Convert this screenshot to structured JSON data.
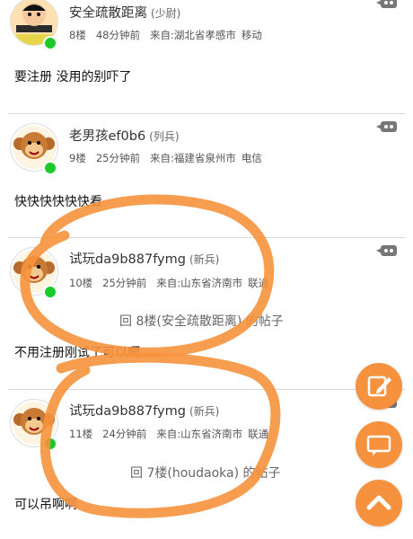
{
  "colors": {
    "accent": "#f6923d",
    "online": "#1cc92b",
    "divider": "#d8d8d8"
  },
  "posts": [
    {
      "avatar": "crayon-shin-chan-avatar",
      "username": "安全疏散距离",
      "rank": "(少尉)",
      "floor": "8楼",
      "time": "48分钟前",
      "location": "来自:湖北省孝感市",
      "carrier": "移动",
      "content": "要注册 没用的别吓了"
    },
    {
      "avatar": "monkey-avatar",
      "username": "老男孩ef0b6",
      "rank": "(列兵)",
      "floor": "9楼",
      "time": "25分钟前",
      "location": "来自:福建省泉州市",
      "carrier": "电信",
      "content": "快快快快快快看"
    },
    {
      "avatar": "monkey-avatar",
      "username": "试玩da9b887fymg",
      "rank": "(新兵)",
      "floor": "10楼",
      "time": "25分钟前",
      "location": "来自:山东省济南市",
      "carrier": "联通",
      "quote": "回 8楼(安全疏散距离) 的帖子",
      "content": "不用注册刚试了可以啊"
    },
    {
      "avatar": "monkey-avatar",
      "username": "试玩da9b887fymg",
      "rank": "(新兵)",
      "floor": "11楼",
      "time": "24分钟前",
      "location": "来自:山东省济南市",
      "carrier": "联通",
      "quote": "回 7楼(houdaoka) 的帖子",
      "content": "可以吊啊啊"
    }
  ],
  "floating_buttons": [
    {
      "name": "edit",
      "icon": "edit-icon"
    },
    {
      "name": "comment",
      "icon": "comment-icon"
    },
    {
      "name": "scroll-top",
      "icon": "chevron-up-icon"
    }
  ]
}
